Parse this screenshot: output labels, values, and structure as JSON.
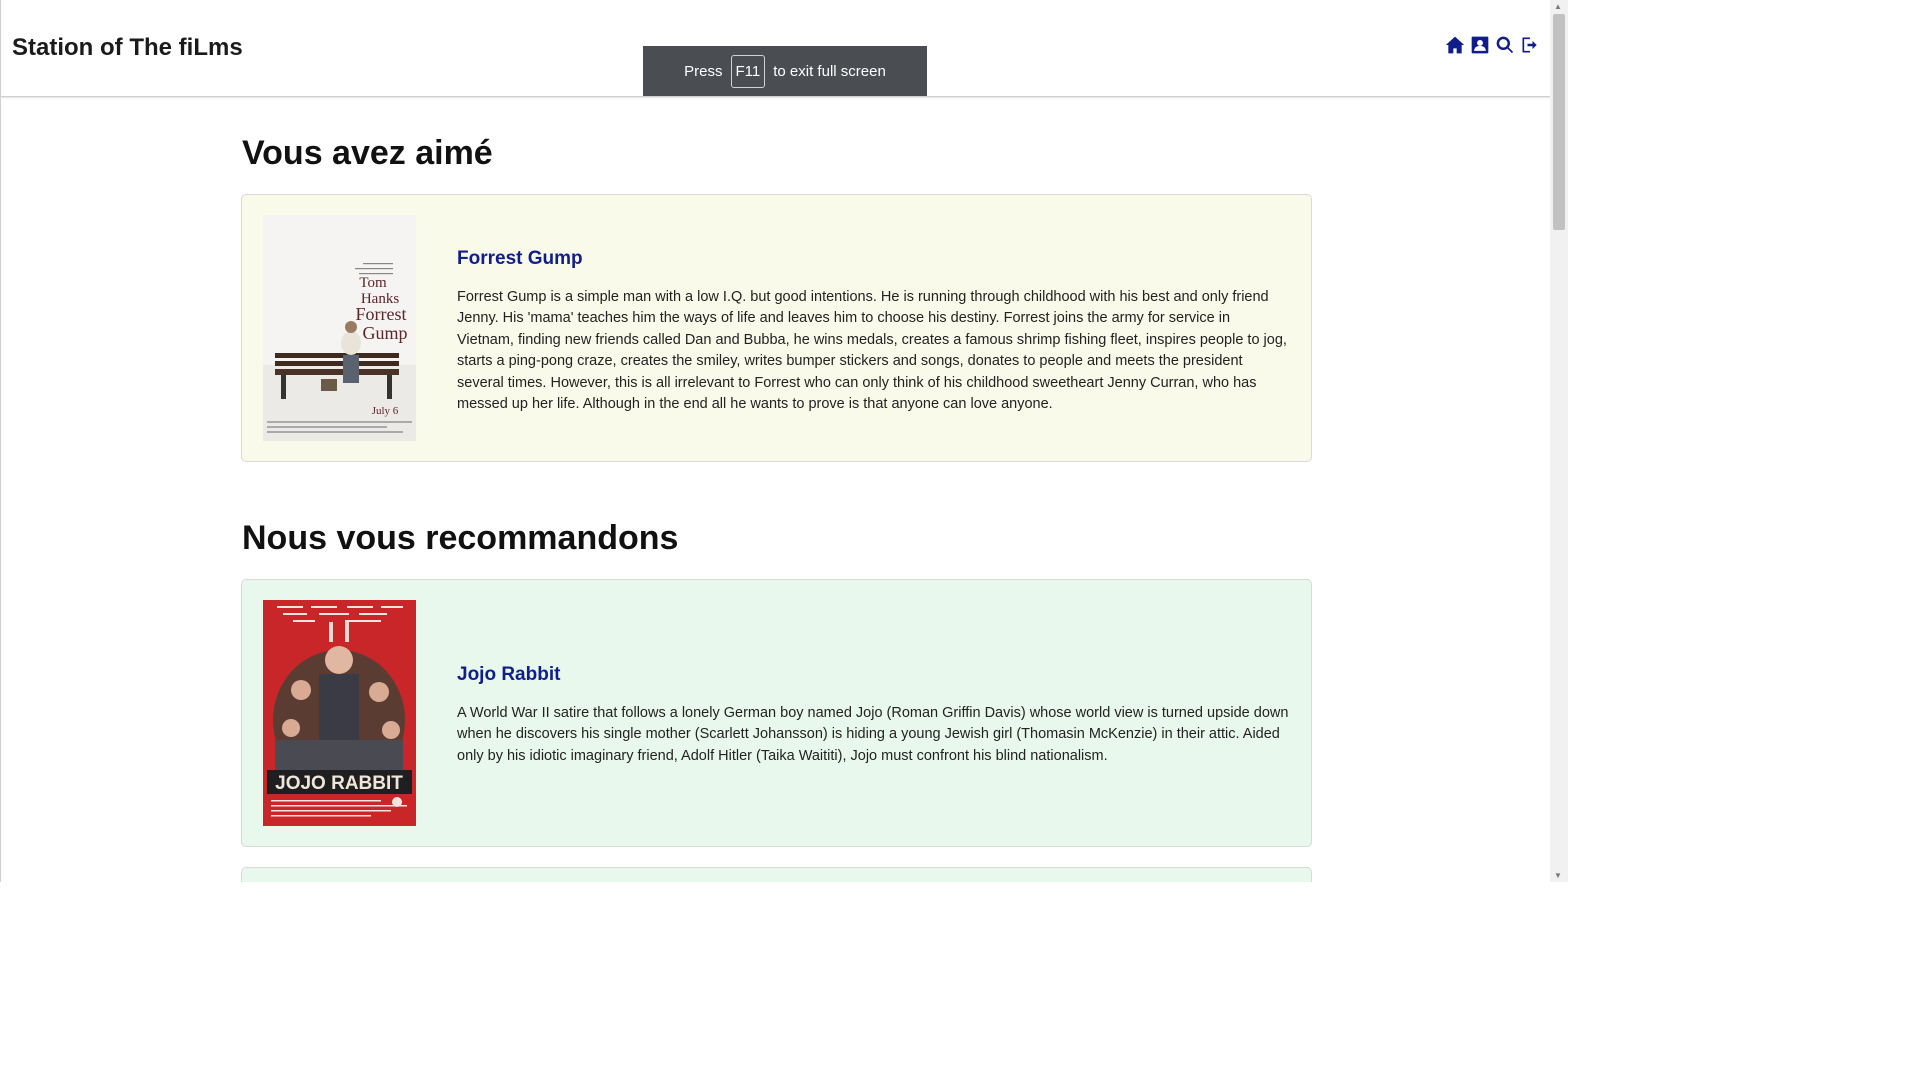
{
  "app": {
    "title": "Station of The fiLms"
  },
  "nav": {
    "icons": [
      "home-icon",
      "user-profile-icon",
      "search-icon",
      "logout-icon"
    ]
  },
  "fullscreen_toast": {
    "prefix": "Press",
    "key": "F11",
    "suffix": "to exit full screen"
  },
  "sections": {
    "liked": {
      "title": "Vous avez aimé",
      "film": {
        "title": "Forrest Gump",
        "description": "Forrest Gump is a simple man with a low I.Q. but good intentions. He is running through childhood with his best and only friend Jenny. His 'mama' teaches him the ways of life and leaves him to choose his destiny. Forrest joins the army for service in Vietnam, finding new friends called Dan and Bubba, he wins medals, creates a famous shrimp fishing fleet, inspires people to jog, starts a ping-pong craze, creates the smiley, writes bumper stickers and songs, donates to people and meets the president several times. However, this is all irrelevant to Forrest who can only think of his childhood sweetheart Jenny Curran, who has messed up her life. Although in the end all he wants to prove is that anyone can love anyone.",
        "poster_text": {
          "line1": "Tom",
          "line2": "Hanks",
          "line3": "Forrest",
          "line4": "Gump",
          "date": "July 6"
        }
      }
    },
    "recommended": {
      "title": "Nous vous recommandons",
      "film": {
        "title": "Jojo Rabbit",
        "description": "A World War II satire that follows a lonely German boy named Jojo (Roman Griffin Davis) whose world view is turned upside down when he discovers his single mother (Scarlett Johansson) is hiding a young Jewish girl (Thomasin McKenzie) in their attic. Aided only by his idiotic imaginary friend, Adolf Hitler (Taika Waititi), Jojo must confront his blind nationalism.",
        "poster_text": {
          "title": "JOJO RABBIT"
        }
      }
    }
  },
  "colors": {
    "brand_link": "#0f1e8c",
    "liked_card_bg": "#fafaeb",
    "recommended_card_bg": "#e9f8ec"
  }
}
